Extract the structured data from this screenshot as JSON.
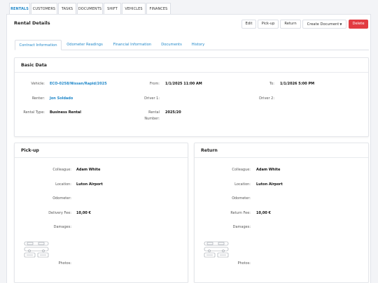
{
  "top_tabs": [
    {
      "label": "RENTALS",
      "active": true
    },
    {
      "label": "CUSTOMERS",
      "active": false
    },
    {
      "label": "TASKS",
      "active": false
    },
    {
      "label": "DOCUMENTS",
      "active": false
    },
    {
      "label": "SHIFT",
      "active": false
    },
    {
      "label": "VEHICLES",
      "active": false
    },
    {
      "label": "FINANCES",
      "active": false
    }
  ],
  "page_title": "Rental Details",
  "actions": {
    "edit": "Edit",
    "pickup": "Pick-up",
    "return": "Return",
    "create_document": "Create Document",
    "delete": "Delete"
  },
  "section_tabs": [
    {
      "label": "Contract Information",
      "active": true
    },
    {
      "label": "Odometer Readings",
      "active": false
    },
    {
      "label": "Financial Information",
      "active": false
    },
    {
      "label": "Documents",
      "active": false
    },
    {
      "label": "History",
      "active": false
    }
  ],
  "basic_data": {
    "title": "Basic Data",
    "vehicle_label": "Vehicle:",
    "vehicle_value": "ECO-0258/Nissan/Rapid/2025",
    "from_label": "From:",
    "from_value": "1/1/2025 11:00 AM",
    "to_label": "To:",
    "to_value": "1/1/2026 5:00 PM",
    "renter_label": "Renter:",
    "renter_value": "Jon Soldado",
    "driver1_label": "Driver 1:",
    "driver2_label": "Driver 2:",
    "rental_type_label": "Rental Type:",
    "rental_type_value": "Business Rental",
    "rental_number_label_1": "Rental",
    "rental_number_label_2": "Number:",
    "rental_number_value": "2025/20"
  },
  "pickup": {
    "title": "Pick-up",
    "colleague_label": "Colleague:",
    "colleague_value": "Adam White",
    "location_label": "Location:",
    "location_value": "Luton Airport",
    "odometer_label": "Odometer:",
    "fee_label": "Delivery Fee:",
    "fee_value": "10,00 €",
    "damages_label": "Damages:",
    "photos_label": "Photos:"
  },
  "return": {
    "title": "Return",
    "colleague_label": "Colleague:",
    "colleague_value": "Adam White",
    "location_label": "Location:",
    "location_value": "Luton Airport",
    "odometer_label": "Odometer:",
    "fee_label": "Return Fee:",
    "fee_value": "10,00 €",
    "damages_label": "Damages:",
    "photos_label": "Photos:"
  },
  "colors": {
    "accent": "#1f87c9",
    "danger": "#e23b41"
  }
}
